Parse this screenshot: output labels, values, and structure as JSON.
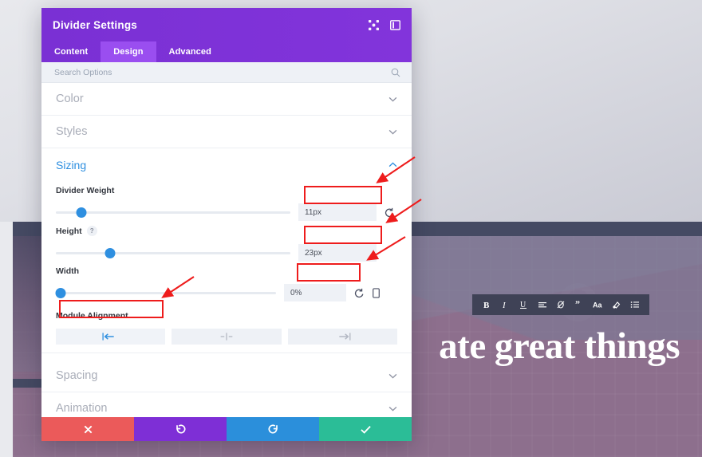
{
  "background": {
    "hero_heading": "ate great things",
    "rich_text_toolbar": [
      {
        "name": "bold-icon",
        "label": "B"
      },
      {
        "name": "italic-icon",
        "label": "I"
      },
      {
        "name": "underline-icon",
        "label": "U"
      },
      {
        "name": "align-left-icon",
        "label": "≡"
      },
      {
        "name": "unlink-icon",
        "label": "⌀"
      },
      {
        "name": "blockquote-icon",
        "label": "”"
      },
      {
        "name": "font-size-icon",
        "label": "Aa"
      },
      {
        "name": "text-color-icon",
        "label": "⚘"
      },
      {
        "name": "bullet-list-icon",
        "label": "☰"
      }
    ]
  },
  "modal": {
    "title": "Divider Settings",
    "header_icons": [
      {
        "name": "move-icon",
        "label": "move"
      },
      {
        "name": "layout-panel-icon",
        "label": "layout"
      }
    ],
    "tabs": [
      {
        "label": "Content",
        "active": false
      },
      {
        "label": "Design",
        "active": true
      },
      {
        "label": "Advanced",
        "active": false
      }
    ],
    "search": {
      "placeholder": "Search Options",
      "value": "",
      "icon": "search-icon"
    },
    "sections": [
      {
        "label": "Color",
        "open": false,
        "chevron": "chevron-down-icon"
      },
      {
        "label": "Styles",
        "open": false,
        "chevron": "chevron-down-icon"
      },
      {
        "label": "Sizing",
        "open": true,
        "chevron": "chevron-up-icon"
      },
      {
        "label": "Spacing",
        "open": false,
        "chevron": "chevron-down-icon"
      },
      {
        "label": "Animation",
        "open": false,
        "chevron": "chevron-down-icon"
      }
    ],
    "sizing": {
      "divider_weight": {
        "label": "Divider Weight",
        "value": "11px",
        "slider_percent": 11,
        "reset_icon": "reset-icon"
      },
      "height": {
        "label": "Height",
        "help": "?",
        "value": "23px",
        "slider_percent": 23
      },
      "width": {
        "label": "Width",
        "value": "0%",
        "slider_percent": 0,
        "reset_icon": "reset-icon",
        "responsive_icon": "mobile-device-icon"
      },
      "module_alignment": {
        "label": "Module Alignment",
        "options": [
          {
            "name": "align-left-button",
            "icon": "align-left-icon",
            "active": true
          },
          {
            "name": "align-center-button",
            "icon": "align-center-icon",
            "active": false
          },
          {
            "name": "align-right-button",
            "icon": "align-right-icon",
            "active": false
          }
        ]
      }
    },
    "footer_buttons": [
      {
        "name": "cancel-button",
        "icon": "close-icon",
        "glyph": "✖",
        "color": "#eb5a5a"
      },
      {
        "name": "undo-button",
        "icon": "undo-icon",
        "glyph": "↺",
        "color": "#7e2fd6"
      },
      {
        "name": "redo-button",
        "icon": "redo-icon",
        "glyph": "↻",
        "color": "#2b8fdb"
      },
      {
        "name": "save-button",
        "icon": "check-icon",
        "glyph": "✔",
        "color": "#2bbd97"
      }
    ]
  },
  "annotations": {
    "color": "#ee1c1c",
    "highlight_count": 4
  }
}
